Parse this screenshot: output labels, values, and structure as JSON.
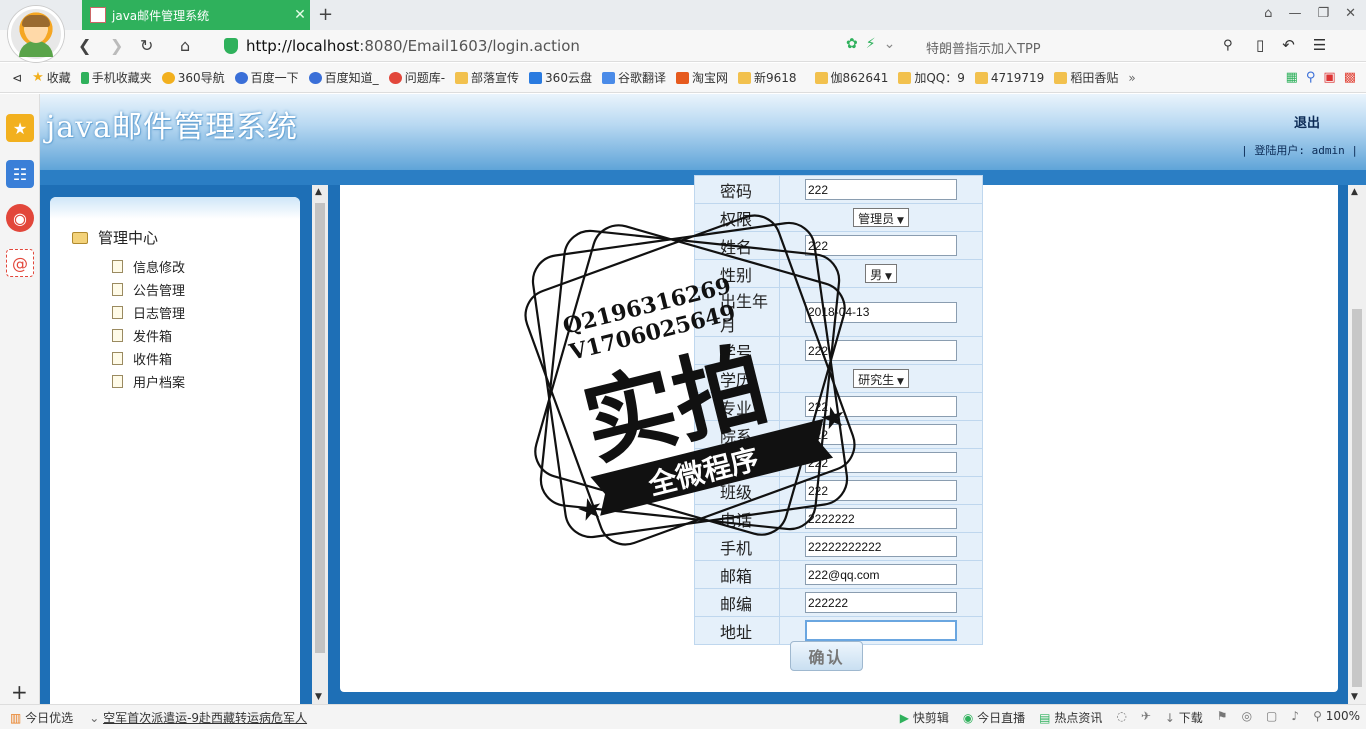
{
  "browser": {
    "tab_title": "java邮件管理系统",
    "url_host": "http://localhost",
    "url_rest": ":8080/Email1603/login.action",
    "search_hint": "特朗普指示加入TPP",
    "bookmarks": [
      "收藏",
      "手机收藏夹",
      "360导航",
      "百度一下",
      "百度知道_",
      "问题库-",
      "部落宣传",
      "360云盘",
      "谷歌翻译",
      "淘宝网",
      "新9618",
      "伽862641",
      "加QQ：9",
      "4719719",
      "稻田香贴"
    ]
  },
  "header": {
    "title": "java邮件管理系统",
    "logout": "退出",
    "user_prefix": "| 登陆用户:",
    "user": "admin",
    "user_suffix": "|"
  },
  "sidebar": {
    "root": "管理中心",
    "items": [
      {
        "label": "信息修改"
      },
      {
        "label": "公告管理"
      },
      {
        "label": "日志管理"
      },
      {
        "label": "发件箱"
      },
      {
        "label": "收件箱"
      },
      {
        "label": "用户档案"
      }
    ]
  },
  "form": {
    "rows": [
      {
        "label": "密码",
        "value": "222",
        "kind": "input"
      },
      {
        "label": "权限",
        "value": "管理员",
        "kind": "select"
      },
      {
        "label": "姓名",
        "value": "222",
        "kind": "input"
      },
      {
        "label": "性别",
        "value": "男",
        "kind": "select"
      },
      {
        "label": "出生年月",
        "value": "2018-04-13",
        "kind": "input"
      },
      {
        "label": "学号",
        "value": "222",
        "kind": "input"
      },
      {
        "label": "学历",
        "value": "研究生",
        "kind": "select"
      },
      {
        "label": "专业",
        "value": "222",
        "kind": "input"
      },
      {
        "label": "院系",
        "value": "222",
        "kind": "input"
      },
      {
        "label": "职称",
        "value": "222",
        "kind": "input"
      },
      {
        "label": "班级",
        "value": "222",
        "kind": "input"
      },
      {
        "label": "电话",
        "value": "2222222",
        "kind": "input"
      },
      {
        "label": "手机",
        "value": "22222222222",
        "kind": "input"
      },
      {
        "label": "邮箱",
        "value": "222@qq.com",
        "kind": "input"
      },
      {
        "label": "邮编",
        "value": "222222",
        "kind": "input"
      },
      {
        "label": "地址",
        "value": "",
        "kind": "input"
      }
    ],
    "confirm": "确认"
  },
  "stamp": {
    "line1": "Q2196316269",
    "line2": "V1706025649",
    "big": "实拍",
    "ribbon": "全微程序"
  },
  "status": {
    "left1": "今日优选",
    "left2": "空军首次派遣运-9赴西藏转运病危军人",
    "right": [
      "快剪辑",
      "今日直播",
      "热点资讯",
      "下载",
      "100%"
    ]
  },
  "colors": {
    "brand_green": "#2fb15c",
    "page_blue": "#1e6fb6"
  }
}
